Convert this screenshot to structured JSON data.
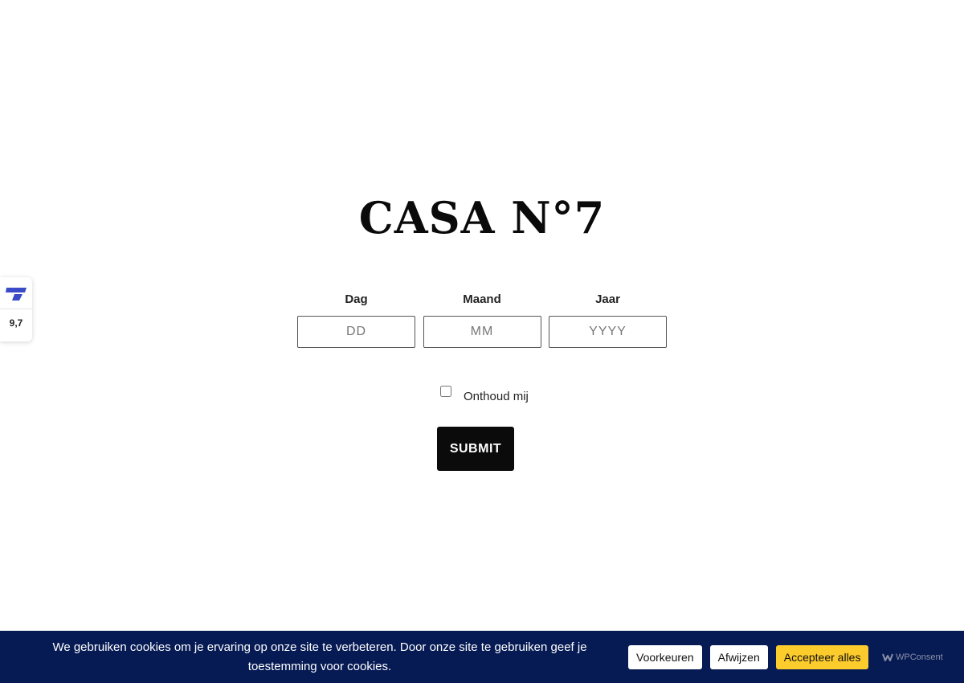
{
  "brand": {
    "logo_text": "CASA N°7"
  },
  "age_gate": {
    "fields": [
      {
        "label": "Dag",
        "placeholder": "DD"
      },
      {
        "label": "Maand",
        "placeholder": "MM"
      },
      {
        "label": "Jaar",
        "placeholder": "YYYY"
      }
    ],
    "remember_label": "Onthoud mij",
    "remember_checked": false,
    "submit_label": "SUBMIT"
  },
  "rating_widget": {
    "score": "9,7",
    "logo_color": "#3b4bc8"
  },
  "cookie_banner": {
    "text": "We gebruiken cookies om je ervaring op onze site te verbeteren. Door onze site te gebruiken geef je toestemming voor cookies.",
    "buttons": {
      "preferences": "Voorkeuren",
      "reject": "Afwijzen",
      "accept": "Accepteer alles"
    },
    "powered_by": "WPConsent",
    "background_color": "#061a54",
    "accept_color": "#fccb2c"
  }
}
